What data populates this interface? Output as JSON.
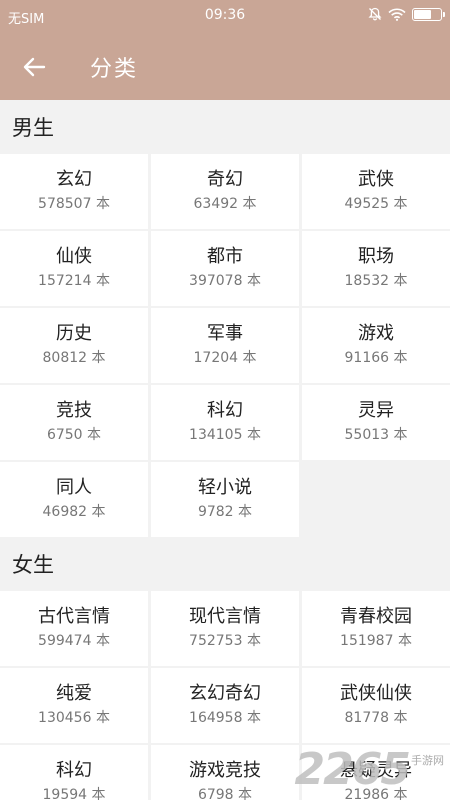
{
  "status_bar": {
    "carrier": "无SIM",
    "time": "09:36",
    "icons": [
      "bell-muted-icon",
      "wifi-icon",
      "battery-icon"
    ]
  },
  "app_bar": {
    "title": "分类",
    "back_icon": "arrow-left-icon"
  },
  "colors": {
    "header_bg": "#c9a696",
    "page_bg": "#f2f2f2",
    "cell_bg": "#ffffff"
  },
  "sections": [
    {
      "title": "男生",
      "items": [
        {
          "name": "玄幻",
          "count": "578507 本"
        },
        {
          "name": "奇幻",
          "count": "63492 本"
        },
        {
          "name": "武侠",
          "count": "49525 本"
        },
        {
          "name": "仙侠",
          "count": "157214 本"
        },
        {
          "name": "都市",
          "count": "397078 本"
        },
        {
          "name": "职场",
          "count": "18532 本"
        },
        {
          "name": "历史",
          "count": "80812 本"
        },
        {
          "name": "军事",
          "count": "17204 本"
        },
        {
          "name": "游戏",
          "count": "91166 本"
        },
        {
          "name": "竞技",
          "count": "6750 本"
        },
        {
          "name": "科幻",
          "count": "134105 本"
        },
        {
          "name": "灵异",
          "count": "55013 本"
        },
        {
          "name": "同人",
          "count": "46982 本"
        },
        {
          "name": "轻小说",
          "count": "9782 本"
        }
      ]
    },
    {
      "title": "女生",
      "items": [
        {
          "name": "古代言情",
          "count": "599474 本"
        },
        {
          "name": "现代言情",
          "count": "752753 本"
        },
        {
          "name": "青春校园",
          "count": "151987 本"
        },
        {
          "name": "纯爱",
          "count": "130456 本"
        },
        {
          "name": "玄幻奇幻",
          "count": "164958 本"
        },
        {
          "name": "武侠仙侠",
          "count": "81778 本"
        },
        {
          "name": "科幻",
          "count": "19594 本"
        },
        {
          "name": "游戏竞技",
          "count": "6798 本"
        },
        {
          "name": "悬疑灵异",
          "count": "21986 本"
        }
      ]
    }
  ],
  "watermark": {
    "logo": "2265",
    "sub": "手游网"
  }
}
